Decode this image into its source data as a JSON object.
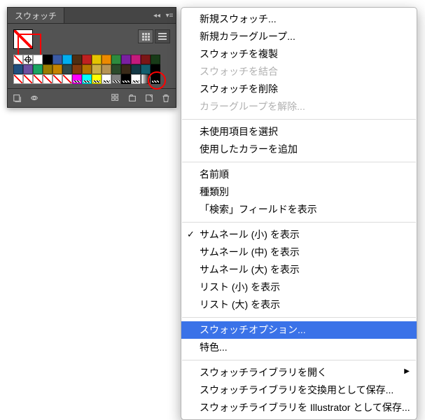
{
  "panel": {
    "title": "スウォッチ",
    "swatch_rows": [
      [
        "none",
        "reg",
        "#ffffff",
        "#000000",
        "#3b5ba5",
        "#00aeef",
        "#4e2e13",
        "#c02020",
        "#e4c400",
        "#ec8a00",
        "#2e8b3e",
        "#7a1fa0",
        "#c41a7c",
        "#7b1616",
        "#183b18"
      ],
      [
        "#205080",
        "#6b4fa0",
        "#1aa562",
        "#9a7b00",
        "#c48300",
        "#304848",
        "#843b0e",
        "#b37400",
        "#cdb148",
        "#b79455",
        "#2b4a2b",
        "#3a2a18",
        "#153a46",
        "#125e6e",
        "#000000"
      ],
      [
        "none",
        "none",
        "none",
        "none",
        "none",
        "none",
        "#ff00ff",
        "#00ffff",
        "#ffff00",
        "#ffffff",
        "#808080",
        "#000000",
        "#ffffff",
        "grad",
        "pat:#000000"
      ]
    ],
    "highlight_cell": {
      "row": 2,
      "col": 14
    }
  },
  "menu": {
    "groups": [
      [
        {
          "label": "新規スウォッチ..."
        },
        {
          "label": "新規カラーグループ..."
        },
        {
          "label": "スウォッチを複製"
        },
        {
          "label": "スウォッチを結合",
          "disabled": true
        },
        {
          "label": "スウォッチを削除"
        },
        {
          "label": "カラーグループを解除...",
          "disabled": true
        }
      ],
      [
        {
          "label": "未使用項目を選択"
        },
        {
          "label": "使用したカラーを追加"
        }
      ],
      [
        {
          "label": "名前順"
        },
        {
          "label": "種類別"
        },
        {
          "label": "「検索」フィールドを表示"
        }
      ],
      [
        {
          "label": "サムネール (小) を表示",
          "checked": true
        },
        {
          "label": "サムネール (中) を表示"
        },
        {
          "label": "サムネール (大) を表示"
        },
        {
          "label": "リスト (小) を表示"
        },
        {
          "label": "リスト (大) を表示"
        }
      ],
      [
        {
          "label": "スウォッチオプション...",
          "highlight": true
        },
        {
          "label": "特色..."
        }
      ],
      [
        {
          "label": "スウォッチライブラリを開く",
          "submenu": true
        },
        {
          "label": "スウォッチライブラリを交換用として保存..."
        },
        {
          "label": "スウォッチライブラリを Illustrator として保存..."
        }
      ]
    ]
  }
}
